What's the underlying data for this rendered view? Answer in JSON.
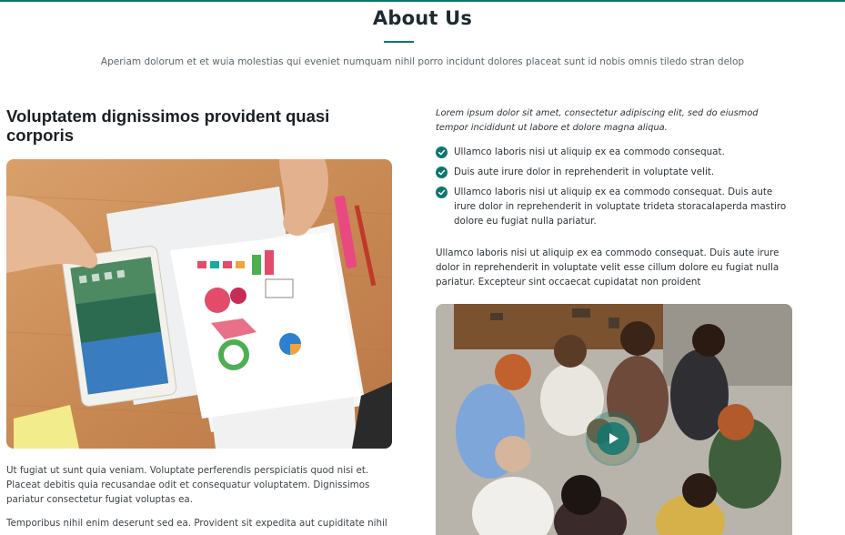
{
  "section": {
    "title": "About Us",
    "subtitle": "Aperiam dolorum et et wuia molestias qui eveniet numquam nihil porro incidunt dolores placeat sunt id nobis omnis tiledo stran delop"
  },
  "left": {
    "heading": "Voluptatem dignissimos provident quasi corporis",
    "paragraph_1": "Ut fugiat ut sunt quia veniam. Voluptate perferendis perspiciatis quod nisi et. Placeat debitis quia recusandae odit et consequatur voluptatem. Dignissimos pariatur consectetur fugiat voluptas ea.",
    "paragraph_2": "Temporibus nihil enim deserunt sed ea. Provident sit expedita aut cupiditate nihil"
  },
  "right": {
    "intro": "Lorem ipsum dolor sit amet, consectetur adipiscing elit, sed do eiusmod tempor incididunt ut labore et dolore magna aliqua.",
    "checklist": [
      "Ullamco laboris nisi ut aliquip ex ea commodo consequat.",
      "Duis aute irure dolor in reprehenderit in voluptate velit.",
      "Ullamco laboris nisi ut aliquip ex ea commodo consequat. Duis aute irure dolor in reprehenderit in voluptate trideta storacalaperda mastiro dolore eu fugiat nulla pariatur."
    ],
    "paragraph": "Ullamco laboris nisi ut aliquip ex ea commodo consequat. Duis aute irure dolor in reprehenderit in voluptate velit esse cillum dolore eu fugiat nulla pariatur. Excepteur sint occaecat cupidatat non proident"
  },
  "icons": {
    "check": "check-circle-icon",
    "play": "play-icon"
  },
  "colors": {
    "accent": "#0f766e",
    "heading": "#1a1f24",
    "body_text": "#3d4449"
  }
}
